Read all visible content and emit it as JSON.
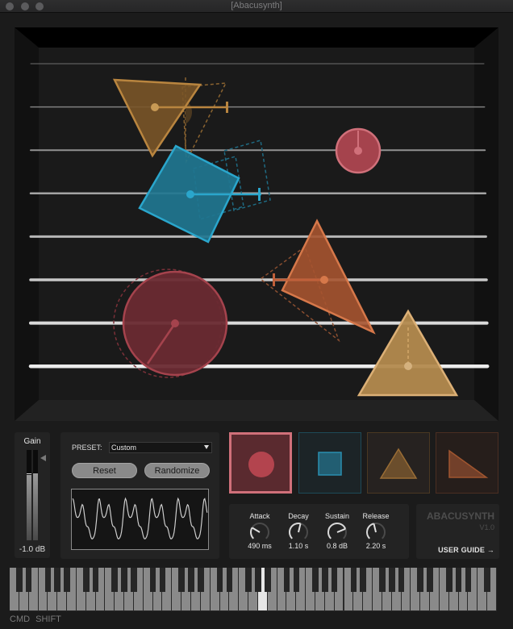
{
  "window": {
    "title": "[Abacusynth]"
  },
  "colors": {
    "red": "#a5434d",
    "red_stroke": "#d0707a",
    "blue": "#1f7690",
    "blue_stroke": "#2aa6cc",
    "ochre": "#7a5528",
    "ochre_stroke": "#b9853f",
    "orange": "#a65430",
    "orange_stroke": "#d6784a",
    "sand": "#b38a4e",
    "sand_stroke": "#dcb076"
  },
  "stage": {
    "rod_count": 8,
    "objects": [
      {
        "name": "ochre-triangle-voice",
        "shape": "triangle",
        "color": "ochre",
        "rod": 1
      },
      {
        "name": "red-small-circle-voice",
        "shape": "circle",
        "color": "red",
        "rod": 2
      },
      {
        "name": "blue-square-voice",
        "shape": "square",
        "color": "blue",
        "rod": 3
      },
      {
        "name": "orange-triangle-voice",
        "shape": "triangle",
        "color": "orange",
        "rod": 5
      },
      {
        "name": "red-large-circle-voice",
        "shape": "circle",
        "color": "red",
        "rod": 6
      },
      {
        "name": "sand-triangle-voice",
        "shape": "triangle",
        "color": "sand",
        "rod": 7
      }
    ]
  },
  "gain": {
    "label": "Gain",
    "value": "-1.0 dB",
    "level_left": 0.72,
    "level_right": 0.74
  },
  "preset": {
    "label": "PRESET:",
    "selected": "Custom",
    "reset_label": "Reset",
    "randomize_label": "Randomize"
  },
  "shapes": [
    {
      "name": "circle",
      "selected": true
    },
    {
      "name": "square",
      "selected": false
    },
    {
      "name": "triangle",
      "selected": false
    },
    {
      "name": "right-triangle",
      "selected": false
    }
  ],
  "envelope": {
    "knobs": [
      {
        "label": "Attack",
        "value": "490 ms",
        "position": 0.28
      },
      {
        "label": "Decay",
        "value": "1.10 s",
        "position": 0.55
      },
      {
        "label": "Sustain",
        "value": "0.8 dB",
        "position": 0.75
      },
      {
        "label": "Release",
        "value": "2.20 s",
        "position": 0.45
      }
    ]
  },
  "info": {
    "brand": "ABACUSYNTH",
    "version": "V1.0",
    "user_guide": "USER GUIDE →"
  },
  "keyboard": {
    "white_keys": 51,
    "first_note": "C",
    "active_white_index": 26
  },
  "modifiers": "CMD SHIFT"
}
